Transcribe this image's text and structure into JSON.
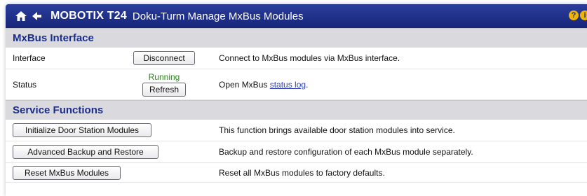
{
  "header": {
    "brand": "MOBOTIX T24",
    "subtitle": "Doku-Turm Manage MxBus Modules",
    "icons": [
      "home-icon",
      "back-arrow-icon",
      "help-icon",
      "info-icon"
    ],
    "help_glyph_1": "?",
    "help_glyph_2": "i"
  },
  "colors": {
    "title_bar": "#1f3090",
    "section_bg": "#d9d9de",
    "section_text": "#1b2d8a",
    "running": "#2a8a1a",
    "link": "#3344bb"
  },
  "mxbus": {
    "heading": "MxBus Interface",
    "interface": {
      "label": "Interface",
      "button": "Disconnect",
      "desc": "Connect to MxBus modules via MxBus interface."
    },
    "status": {
      "label": "Status",
      "state": "Running",
      "button": "Refresh",
      "desc_prefix": "Open MxBus ",
      "link": "status log",
      "desc_suffix": "."
    }
  },
  "service": {
    "heading": "Service Functions",
    "rows": [
      {
        "button": "Initialize Door Station Modules",
        "desc": "This function brings available door station modules into service."
      },
      {
        "button": "Advanced Backup and Restore",
        "desc": "Backup and restore configuration of each MxBus module separately."
      },
      {
        "button": "Reset MxBus Modules",
        "desc": "Reset all MxBus modules to factory defaults."
      }
    ]
  }
}
